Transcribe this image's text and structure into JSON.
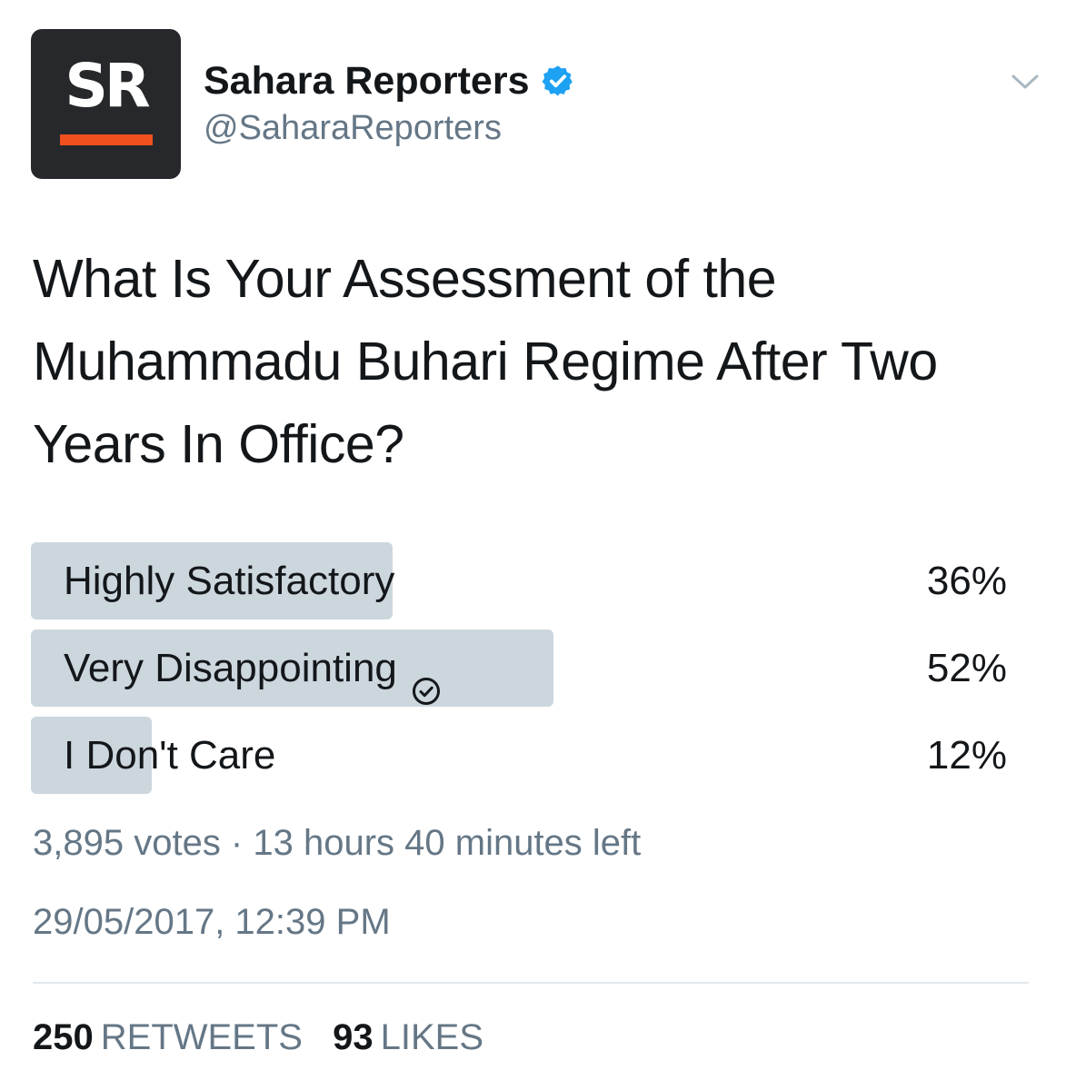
{
  "header": {
    "avatar_text": "SR",
    "display_name": "Sahara Reporters",
    "handle": "@SaharaReporters",
    "verified_icon": "verified-badge-icon",
    "menu_icon": "chevron-down-icon"
  },
  "tweet": {
    "text": "What Is Your Assessment of the Muhammadu Buhari Regime After Two Years In Office?"
  },
  "poll": {
    "options": [
      {
        "label": "Highly Satisfactory",
        "percent_text": "36%",
        "percent": 36,
        "selected": false
      },
      {
        "label": "Very Disappointing",
        "percent_text": "52%",
        "percent": 52,
        "selected": true
      },
      {
        "label": "I Don't Care",
        "percent_text": "12%",
        "percent": 12,
        "selected": false
      }
    ],
    "meta": "3,895 votes · 13 hours 40 minutes left"
  },
  "timestamp": "29/05/2017, 12:39 PM",
  "stats": {
    "retweets_count": "250",
    "retweets_label": "RETWEETS",
    "likes_count": "93",
    "likes_label": "LIKES"
  },
  "colors": {
    "avatar_bg": "#26282b",
    "avatar_accent": "#f0501e",
    "verified": "#1da1f2",
    "poll_bar": "#ccd6dd",
    "secondary_text": "#657786"
  }
}
